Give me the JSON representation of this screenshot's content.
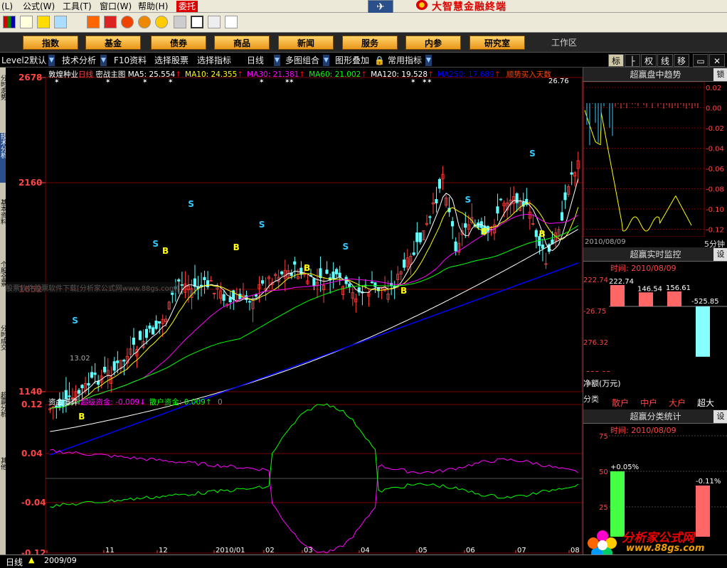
{
  "menu": {
    "items": [
      "(L)",
      "公式(W)",
      "工具(T)",
      "窗口(W)",
      "帮助(H)"
    ],
    "entrust": "委托",
    "brand": "大智慧金融終端"
  },
  "nav": {
    "buttons": [
      "指数",
      "基金",
      "债券",
      "商品",
      "新闻",
      "服务",
      "内参",
      "研究室"
    ],
    "workzone": "工作区"
  },
  "funcbar": {
    "items": [
      "Level2默认",
      "技术分析",
      "F10资料",
      "选择股票",
      "选择指标",
      "日线",
      "多图组合",
      "图形叠加",
      "常用指标"
    ],
    "right_buttons": [
      "标",
      "├",
      "权",
      "线",
      "移"
    ]
  },
  "sidetabs": [
    "分时走势",
    "技术分析",
    "基本资料",
    "个股全景",
    "分时成交",
    "超赢分析",
    "其他"
  ],
  "main_chart": {
    "stock": "敦煌种业",
    "period": "日线",
    "template": "密战主图",
    "ma": [
      {
        "label": "MA5:",
        "value": "25.554",
        "arrow": "↑",
        "color": "#ffffff"
      },
      {
        "label": "MA10:",
        "value": "24.355",
        "arrow": "↑",
        "color": "#ffff00"
      },
      {
        "label": "MA30:",
        "value": "21.381",
        "arrow": "↑",
        "color": "#ff00ff"
      },
      {
        "label": "MA60:",
        "value": "21.002",
        "arrow": "↑",
        "color": "#00ff00"
      },
      {
        "label": "MA120:",
        "value": "19.528",
        "arrow": "↑",
        "color": "#ffffff"
      },
      {
        "label": "MA250:",
        "value": "17.689",
        "arrow": "↑",
        "color": "#0000ff"
      }
    ],
    "signal_text": "顺势买入天数",
    "y_labels": [
      "2678",
      "2160",
      "1652",
      "1140"
    ],
    "low_label": "13.02",
    "high_label": "26.76",
    "watermark": "股票软件股票软件下载[分析家公式网www.88gs.com]"
  },
  "oscillator": {
    "title": "资金博弈",
    "series": [
      {
        "label": "超级资金:",
        "value": "-0.009",
        "arrow": "↓",
        "color": "#ff00ff"
      },
      {
        "label": "散户资金:",
        "value": "0.009",
        "arrow": "↑",
        "color": "#00ff00"
      }
    ],
    "trail": "0",
    "y_labels": [
      "0.12",
      "0.04",
      "-0.04",
      "-0.12"
    ]
  },
  "x_axis": {
    "first_label": "2009/09",
    "labels": [
      "2009/09",
      "11",
      "12",
      "2010/01",
      "02",
      "03",
      "04",
      "05",
      "06",
      "07",
      "08"
    ],
    "bottom_label": "日线"
  },
  "right_panel": {
    "trend": {
      "title": "超赢盘中趋势",
      "lock": "锁",
      "y_labels": [
        "0.02",
        "0.00",
        "-0.02",
        "-0.04",
        "-0.06",
        "-0.08",
        "-0.10",
        "-0.12"
      ],
      "date": "2010/08/09",
      "period": "5分钟"
    },
    "monitor": {
      "title": "超赢实时监控",
      "set": "设",
      "time": "时间: 2010/08/09",
      "y_labels": [
        "222.74",
        "-26.75",
        "276.32",
        "-525.85"
      ],
      "unit": "净额(万元)",
      "category_label": "分类",
      "categories": [
        "散户",
        "中户",
        "大户",
        "超大"
      ],
      "values": [
        222.74,
        146.54,
        156.61,
        -525.85
      ]
    },
    "stats": {
      "title": "超赢分类统计",
      "set": "设",
      "time": "时间: 2010/08/09",
      "y_labels": [
        "75",
        "50",
        "25"
      ],
      "values": [
        "+0.05%",
        "-0.11%"
      ]
    }
  },
  "site": {
    "title": "分析家公式网",
    "url": "www.88gs.com"
  },
  "colors": {
    "up": "#ff4040",
    "down": "#60ffff",
    "grid": "#7a0000",
    "ma5": "#ffffff",
    "ma10": "#ffff00",
    "ma30": "#ff00ff",
    "ma60": "#00ff00",
    "ma120": "#ffffff",
    "ma250": "#0000ff"
  }
}
